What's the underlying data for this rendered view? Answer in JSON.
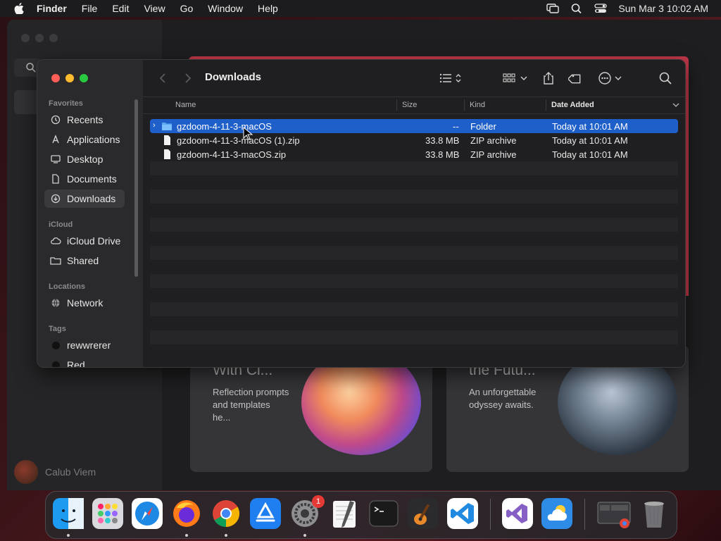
{
  "menubar": {
    "app_name": "Finder",
    "items": [
      "File",
      "Edit",
      "View",
      "Go",
      "Window",
      "Help"
    ],
    "clock": "Sun Mar 3  10:02 AM"
  },
  "background_app": {
    "user_name": "Calub Viem",
    "cards": [
      {
        "title": "With Cl...",
        "desc": "Reflection prompts and templates he..."
      },
      {
        "title": "the Futu...",
        "desc": "An unforgettable odyssey awaits."
      }
    ]
  },
  "finder": {
    "title": "Downloads",
    "sidebar": {
      "sections": [
        {
          "label": "Favorites",
          "items": [
            {
              "label": "Recents",
              "icon": "clock-icon"
            },
            {
              "label": "Applications",
              "icon": "applications-icon"
            },
            {
              "label": "Desktop",
              "icon": "desktop-icon"
            },
            {
              "label": "Documents",
              "icon": "document-icon"
            },
            {
              "label": "Downloads",
              "icon": "download-icon",
              "selected": true
            }
          ]
        },
        {
          "label": "iCloud",
          "items": [
            {
              "label": "iCloud Drive",
              "icon": "cloud-icon"
            },
            {
              "label": "Shared",
              "icon": "shared-folder-icon"
            }
          ]
        },
        {
          "label": "Locations",
          "items": [
            {
              "label": "Network",
              "icon": "globe-icon"
            }
          ]
        },
        {
          "label": "Tags",
          "items": [
            {
              "label": "rewwrerer",
              "icon": "tag-dot-icon"
            },
            {
              "label": "Red",
              "icon": "tag-dot-icon"
            }
          ]
        }
      ]
    },
    "columns": {
      "name": "Name",
      "size": "Size",
      "kind": "Kind",
      "date_added": "Date Added"
    },
    "files": [
      {
        "name": "gzdoom-4-11-3-macOS",
        "size": "--",
        "kind": "Folder",
        "date": "Today at 10:01 AM",
        "type": "folder",
        "selected": true
      },
      {
        "name": "gzdoom-4-11-3-macOS (1).zip",
        "size": "33.8 MB",
        "kind": "ZIP archive",
        "date": "Today at 10:01 AM",
        "type": "file"
      },
      {
        "name": "gzdoom-4-11-3-macOS.zip",
        "size": "33.8 MB",
        "kind": "ZIP archive",
        "date": "Today at 10:01 AM",
        "type": "file"
      }
    ]
  },
  "dock": {
    "apps": [
      {
        "name": "finder-icon",
        "color": "#2f8cf0"
      },
      {
        "name": "launchpad-icon",
        "color": "#d8d8dc"
      },
      {
        "name": "safari-icon",
        "color": "#1e88e5"
      },
      {
        "name": "firefox-icon",
        "color": "#ff7a18"
      },
      {
        "name": "chrome-icon",
        "color": "#ffffff"
      },
      {
        "name": "app-store-icon",
        "color": "#1f7ff0"
      },
      {
        "name": "system-settings-icon",
        "color": "#8e8e93",
        "badge": "1"
      },
      {
        "name": "textedit-icon",
        "color": "#f2f2f2"
      },
      {
        "name": "terminal-icon",
        "color": "#1a1a1a"
      },
      {
        "name": "garageband-icon",
        "color": "#3a2a1a"
      },
      {
        "name": "vscode-icon",
        "color": "#ffffff"
      },
      {
        "name": "visual-studio-icon",
        "color": "#ffffff"
      },
      {
        "name": "weather-icon",
        "color": "#2e8be6"
      },
      {
        "name": "chrome-window-icon",
        "color": "#3a3a3e"
      },
      {
        "name": "trash-icon",
        "color": "#6e6e72"
      }
    ],
    "colors": {
      "selection": "#1f5fc9"
    }
  }
}
